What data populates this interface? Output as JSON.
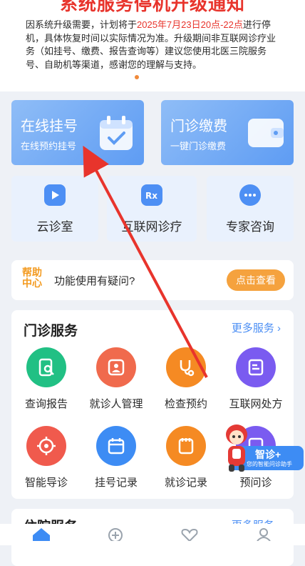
{
  "notice": {
    "title": "系统服务停机升级通知",
    "line_prefix": "因系统升级需要，计划将于",
    "highlight": "2025年7月23日20点-22点",
    "line_suffix": "进行停机，具体恢复时间以实际情况为准。升级期间非互联网诊疗业务（如挂号、缴费、报告查询等）建议您使用北医三院服务号、自助机等渠道，感谢您的理解与支持。"
  },
  "top_cards": [
    {
      "title": "在线挂号",
      "subtitle": "在线预约挂号",
      "icon": "calendar-check-icon"
    },
    {
      "title": "门诊缴费",
      "subtitle": "一键门诊缴费",
      "icon": "wallet-icon"
    }
  ],
  "tiles": [
    {
      "label": "云诊室",
      "icon": "video-icon"
    },
    {
      "label": "互联网诊疗",
      "icon": "rx-icon"
    },
    {
      "label": "专家咨询",
      "icon": "chat-icon"
    }
  ],
  "help": {
    "logo_line1": "帮助",
    "logo_line2": "中心",
    "question": "功能使用有疑问?",
    "button": "点击查看"
  },
  "outpatient": {
    "title": "门诊服务",
    "more": "更多服务 ›",
    "items": [
      {
        "label": "查询报告",
        "icon": "report-search-icon",
        "color": "#21c084"
      },
      {
        "label": "就诊人管理",
        "icon": "patient-card-icon",
        "color": "#f06a4d"
      },
      {
        "label": "检查预约",
        "icon": "stethoscope-icon",
        "color": "#f58a23"
      },
      {
        "label": "互联网处方",
        "icon": "prescription-icon",
        "color": "#7a5bf0"
      },
      {
        "label": "智能导诊",
        "icon": "target-icon",
        "color": "#f05a4d"
      },
      {
        "label": "挂号记录",
        "icon": "calendar-icon",
        "color": "#3d8cf4"
      },
      {
        "label": "就诊记录",
        "icon": "record-icon",
        "color": "#f58a23"
      },
      {
        "label": "预问诊",
        "icon": "pre-consult-icon",
        "color": "#7a5bf0"
      }
    ]
  },
  "inpatient": {
    "title": "住院服务",
    "more": "更多服务 ›"
  },
  "assistant": {
    "title": "智诊+",
    "subtitle": "您的智能问诊助手"
  },
  "colors": {
    "accent": "#4c8ff4",
    "orange": "#f5a23e",
    "red": "#e8342c"
  }
}
